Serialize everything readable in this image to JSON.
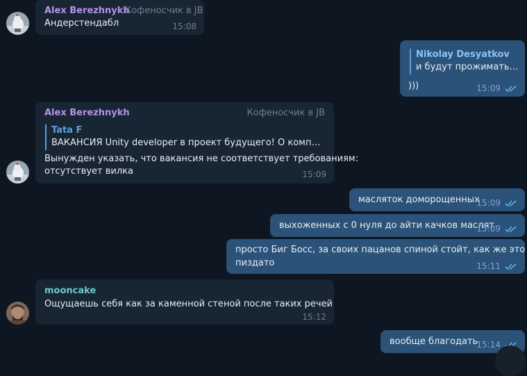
{
  "colors": {
    "background": "#0e1621",
    "incoming_bubble": "#182533",
    "outgoing_bubble": "#2b5278",
    "alex_name": "#b493e8",
    "quote_accent": "#5fa0de",
    "mooncake_name": "#6ccac6",
    "read_ticks": "#5fb4f5"
  },
  "messages": [
    {
      "sender": "Alex Berezhnykh",
      "role": "Кофеносчик в JB",
      "text": "Андерстендабл",
      "time": "15:08"
    },
    {
      "reply_to": {
        "name": "Nikolay Desyatkov",
        "text": "и будут прожимать м..."
      },
      "text": ")))",
      "time": "15:09",
      "status_icon": "double-check-icon"
    },
    {
      "sender": "Alex Berezhnykh",
      "role": "Кофеносчик в JB",
      "reply_to": {
        "name": "Tata F",
        "text": "ВАКАНСИЯ Unity developer в проект будущего! О компании: i-..."
      },
      "lines": [
        "Вынужден указать, что вакансия не соответствует требованиям:",
        "отсутствует вилка"
      ],
      "time": "15:09"
    },
    {
      "text": "масляток доморощенных",
      "time": "15:09",
      "status_icon": "double-check-icon"
    },
    {
      "text": "выхоженных с 0 нуля до айти качков маслят",
      "time": "15:09",
      "status_icon": "double-check-icon"
    },
    {
      "lines": [
        "просто Биг Босс, за своих пацанов спиной стойт, как же это",
        "пиздато"
      ],
      "time": "15:11",
      "status_icon": "double-check-icon"
    },
    {
      "sender": "mooncake",
      "text": "Ощущаешь себя как за каменной стеной после таких речей",
      "time": "15:12"
    },
    {
      "text": "вообще благодать",
      "time": "15:14",
      "status_icon": "double-check-icon"
    }
  ]
}
